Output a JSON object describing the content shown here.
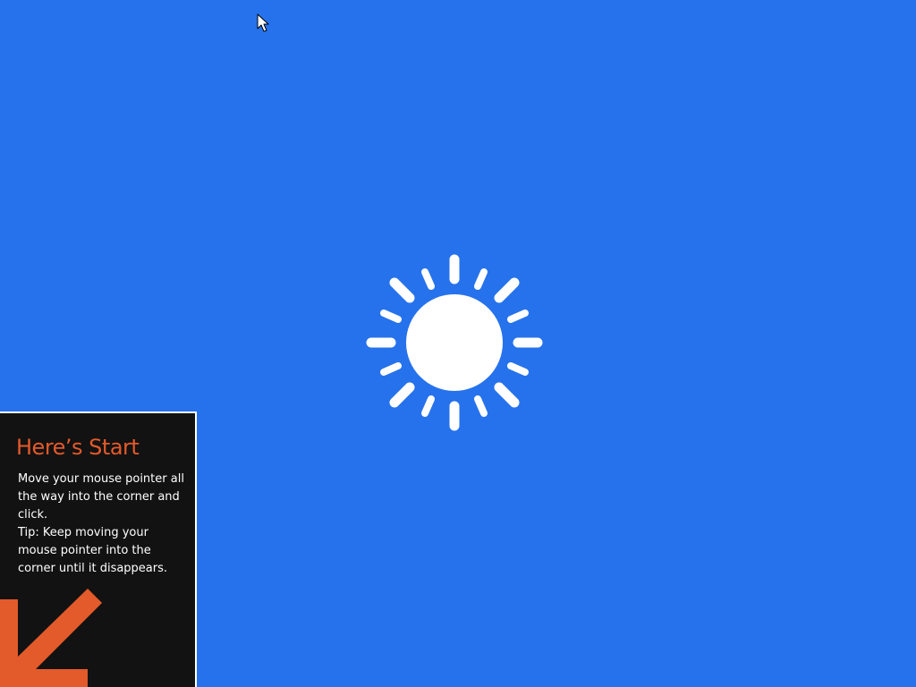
{
  "background_color": "#2672EC",
  "start_tip": {
    "title": "Here’s Start",
    "instruction": "Move your mouse pointer all the way into the corner and click.",
    "tip": "Tip: Keep moving your mouse pointer into the corner until it disappears.",
    "title_color": "#E35A2B",
    "panel_color": "#121212",
    "arrow_color": "#E35A2B",
    "arrow_icon": "arrow-down-left-icon"
  },
  "loading_icon": "sun-icon"
}
